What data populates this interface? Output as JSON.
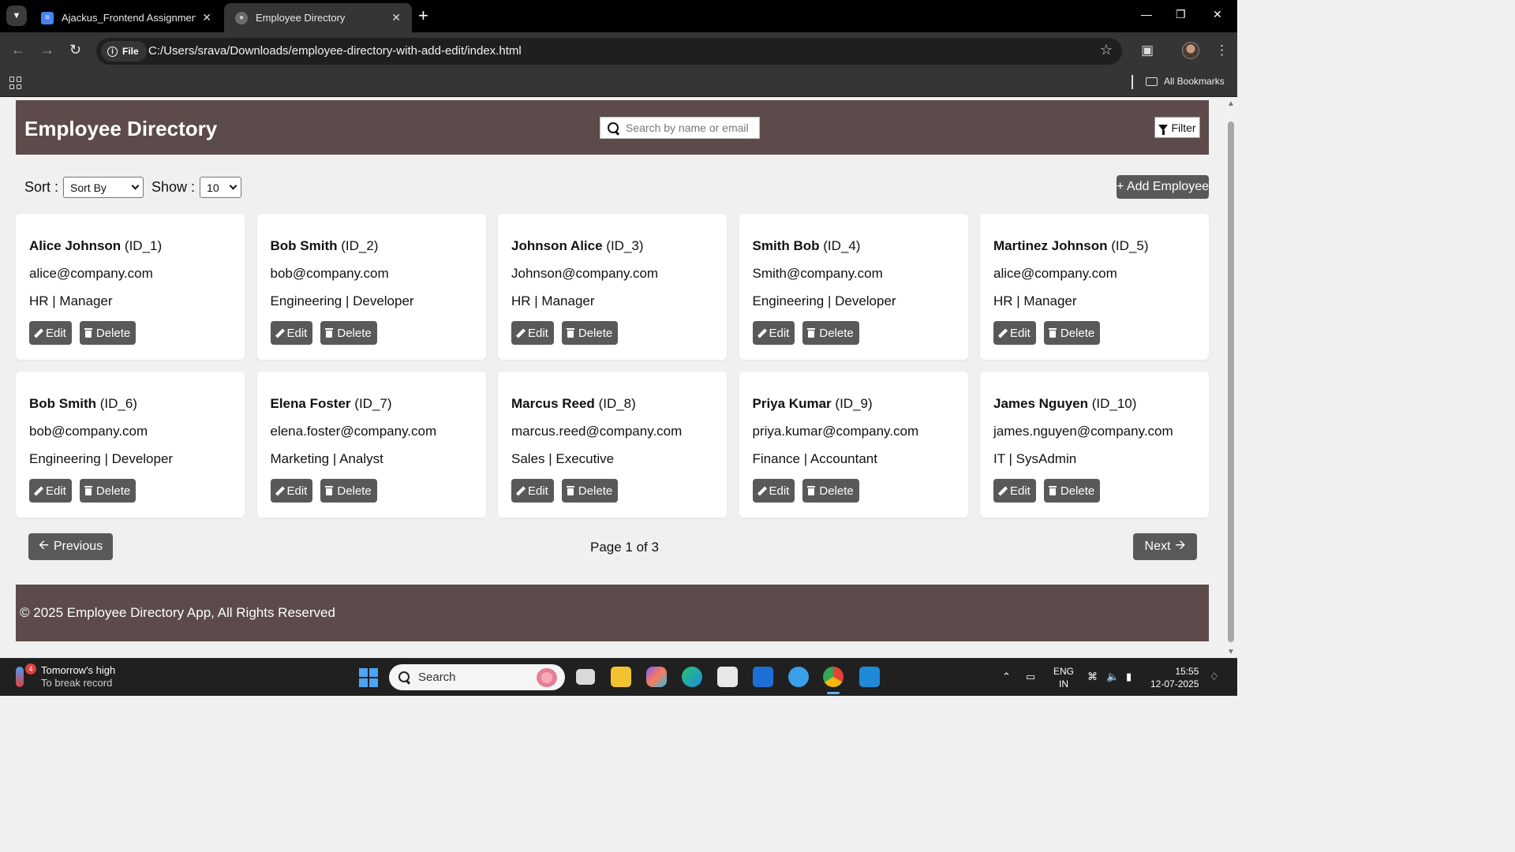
{
  "browser": {
    "tabs": [
      {
        "title": "Ajackus_Frontend Assignment -",
        "active": false
      },
      {
        "title": "Employee Directory",
        "active": true
      }
    ],
    "address": {
      "chip": "File",
      "url": "C:/Users/srava/Downloads/employee-directory-with-add-edit/index.html"
    },
    "bookmarks_label": "All Bookmarks"
  },
  "header": {
    "title": "Employee Directory",
    "search_placeholder": "Search by name or email",
    "filter_label": "Filter"
  },
  "controls": {
    "sort_label": "Sort :",
    "sort_value": "Sort By",
    "show_label": "Show :",
    "show_value": "10",
    "add_label": "+ Add Employee"
  },
  "employees": [
    {
      "name": "Alice Johnson",
      "id": "(ID_1)",
      "email": "alice@company.com",
      "role": "HR | Manager"
    },
    {
      "name": "Bob Smith",
      "id": "(ID_2)",
      "email": "bob@company.com",
      "role": "Engineering | Developer"
    },
    {
      "name": "Johnson Alice",
      "id": "(ID_3)",
      "email": "Johnson@company.com",
      "role": "HR | Manager"
    },
    {
      "name": "Smith Bob",
      "id": "(ID_4)",
      "email": "Smith@company.com",
      "role": "Engineering | Developer"
    },
    {
      "name": "Martinez Johnson",
      "id": "(ID_5)",
      "email": "alice@company.com",
      "role": "HR | Manager"
    },
    {
      "name": "Bob Smith",
      "id": "(ID_6)",
      "email": "bob@company.com",
      "role": "Engineering | Developer"
    },
    {
      "name": "Elena Foster",
      "id": "(ID_7)",
      "email": "elena.foster@company.com",
      "role": "Marketing | Analyst"
    },
    {
      "name": "Marcus Reed",
      "id": "(ID_8)",
      "email": "marcus.reed@company.com",
      "role": "Sales | Executive"
    },
    {
      "name": "Priya Kumar",
      "id": "(ID_9)",
      "email": "priya.kumar@company.com",
      "role": "Finance | Accountant"
    },
    {
      "name": "James Nguyen",
      "id": "(ID_10)",
      "email": "james.nguyen@company.com",
      "role": "IT | SysAdmin"
    }
  ],
  "card_actions": {
    "edit": "Edit",
    "delete": "Delete"
  },
  "pagination": {
    "prev": "Previous",
    "next": "Next",
    "info": "Page 1 of 3"
  },
  "footer": {
    "text": "© 2025 Employee Directory App, All Rights Reserved"
  },
  "taskbar": {
    "weather_line1": "Tomorrow's high",
    "weather_line2": "To break record",
    "weather_badge": "4",
    "search_label": "Search",
    "lang1": "ENG",
    "lang2": "IN",
    "time": "15:55",
    "date": "12-07-2025"
  },
  "colors": {
    "header_bg": "#5c4b4a",
    "button_bg": "#595959",
    "page_bg": "#f0f0f0"
  }
}
